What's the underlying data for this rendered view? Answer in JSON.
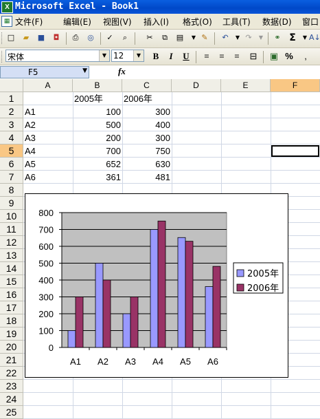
{
  "window": {
    "title": "Microsoft Excel - Book1",
    "app_icon": "excel-icon"
  },
  "menu": [
    "文件(F)",
    "编辑(E)",
    "视图(V)",
    "插入(I)",
    "格式(O)",
    "工具(T)",
    "数据(D)",
    "窗口"
  ],
  "format_bar": {
    "font_name": "宋体",
    "font_size": "12",
    "bold": "B",
    "italic": "I",
    "underline": "U",
    "percent": "%"
  },
  "formula_bar": {
    "name_box": "F5",
    "fx": "fx",
    "formula": ""
  },
  "columns": [
    "A",
    "B",
    "C",
    "D",
    "E",
    "F"
  ],
  "rows": [
    "1",
    "2",
    "3",
    "4",
    "5",
    "6",
    "7",
    "8",
    "9",
    "10",
    "11",
    "12",
    "13",
    "14",
    "15",
    "16",
    "17",
    "18",
    "19",
    "20",
    "21",
    "22",
    "23",
    "24",
    "25"
  ],
  "selected": {
    "column": "F",
    "row": "5"
  },
  "sheet": {
    "header": [
      "",
      "2005年",
      "2006年"
    ],
    "data": [
      [
        "A1",
        "100",
        "300"
      ],
      [
        "A2",
        "500",
        "400"
      ],
      [
        "A3",
        "200",
        "300"
      ],
      [
        "A4",
        "700",
        "750"
      ],
      [
        "A5",
        "652",
        "630"
      ],
      [
        "A6",
        "361",
        "481"
      ]
    ]
  },
  "chart_data": {
    "type": "bar",
    "categories": [
      "A1",
      "A2",
      "A3",
      "A4",
      "A5",
      "A6"
    ],
    "series": [
      {
        "name": "2005年",
        "values": [
          100,
          500,
          200,
          700,
          652,
          361
        ],
        "color": "#9999ff"
      },
      {
        "name": "2006年",
        "values": [
          300,
          400,
          300,
          750,
          630,
          481
        ],
        "color": "#993366"
      }
    ],
    "ylim": [
      0,
      800
    ],
    "yticks": [
      0,
      100,
      200,
      300,
      400,
      500,
      600,
      700,
      800
    ],
    "plot_background": "#c0c0c0",
    "grid": true,
    "legend": "right"
  }
}
